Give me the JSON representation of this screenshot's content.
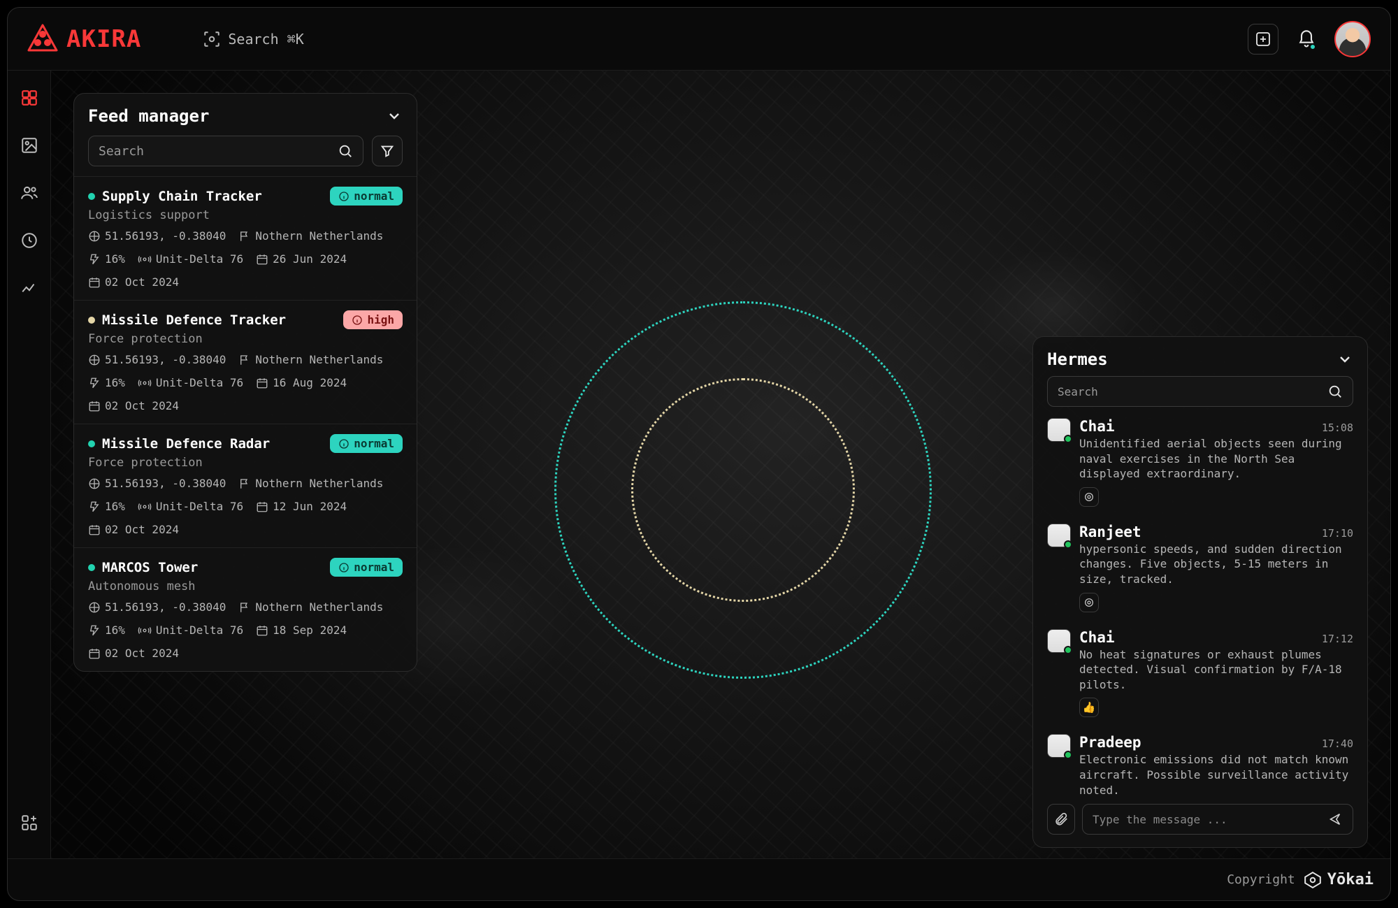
{
  "brand": {
    "name": "AKIRA"
  },
  "search_trigger": "Search ⌘K",
  "feed": {
    "title": "Feed manager",
    "search_placeholder": "Search",
    "items": [
      {
        "dot": "teal",
        "title": "Supply Chain Tracker",
        "subtitle": "Logistics support",
        "status": "normal",
        "coords": "51.56193, -0.38040",
        "region": "Nothern Netherlands",
        "power": "16%",
        "unit": "Unit-Delta 76",
        "date1": "26 Jun 2024",
        "date2": "02 Oct 2024"
      },
      {
        "dot": "yellow",
        "title": "Missile Defence Tracker",
        "subtitle": "Force protection",
        "status": "high",
        "coords": "51.56193, -0.38040",
        "region": "Nothern Netherlands",
        "power": "16%",
        "unit": "Unit-Delta 76",
        "date1": "16 Aug 2024",
        "date2": "02 Oct 2024"
      },
      {
        "dot": "teal",
        "title": "Missile Defence Radar",
        "subtitle": "Force protection",
        "status": "normal",
        "coords": "51.56193, -0.38040",
        "region": "Nothern Netherlands",
        "power": "16%",
        "unit": "Unit-Delta 76",
        "date1": "12 Jun 2024",
        "date2": "02 Oct 2024"
      },
      {
        "dot": "teal",
        "title": "MARCOS Tower",
        "subtitle": "Autonomous mesh",
        "status": "normal",
        "coords": "51.56193, -0.38040",
        "region": "Nothern Netherlands",
        "power": "16%",
        "unit": "Unit-Delta 76",
        "date1": "18 Sep 2024",
        "date2": "02 Oct 2024"
      }
    ]
  },
  "hermes": {
    "title": "Hermes",
    "search_placeholder": "Search",
    "compose_placeholder": "Type the message ...",
    "messages": [
      {
        "name": "Chai",
        "time": "15:08",
        "text": "Unidentified aerial objects seen during naval exercises in the North Sea displayed extraordinary.",
        "react": "target"
      },
      {
        "name": "Ranjeet",
        "time": "17:10",
        "text": "hypersonic speeds, and sudden direction changes. Five objects, 5-15 meters in size, tracked.",
        "react": "target"
      },
      {
        "name": "Chai",
        "time": "17:12",
        "text": "No heat signatures or exhaust plumes detected. Visual confirmation by F/A-18 pilots.",
        "react": "thumbs"
      },
      {
        "name": "Pradeep",
        "time": "17:40",
        "text": "Electronic emissions did not match known aircraft. Possible surveillance activity noted.",
        "react": "target"
      }
    ]
  },
  "footer": {
    "copyright": "Copyright",
    "vendor": "Yōkai"
  }
}
